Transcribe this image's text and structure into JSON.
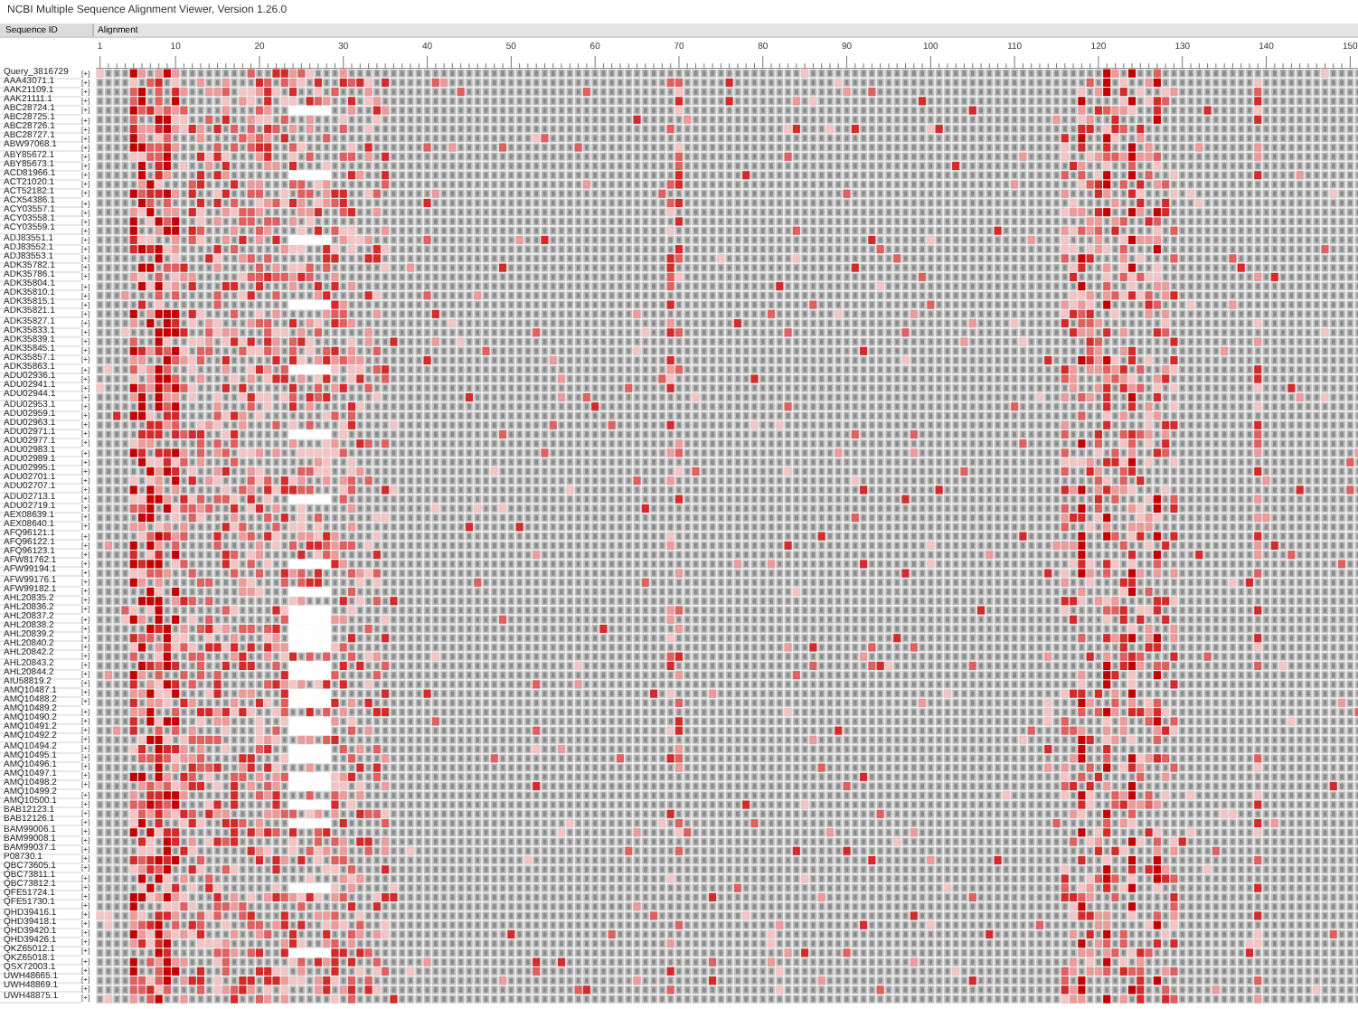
{
  "window": {
    "title": "NCBI Multiple Sequence Alignment Viewer, Version 1.26.0"
  },
  "header": {
    "columns": [
      "Sequence ID",
      "Alignment"
    ]
  },
  "ruler": {
    "labels": [
      "1",
      "10",
      "20",
      "30",
      "40",
      "50",
      "60",
      "70",
      "80",
      "90",
      "100",
      "110",
      "120",
      "130",
      "140",
      "150"
    ]
  },
  "rows": [
    {
      "id": "Query_3816729",
      "expander": "[+]"
    },
    {
      "id": "AAA43071.1",
      "expander": "[+]"
    },
    {
      "id": "AAK21109.1",
      "expander": "[+]"
    },
    {
      "id": "AAK21111.1",
      "expander": "[+]"
    },
    {
      "id": "ABC28724.1",
      "expander": "[+]"
    },
    {
      "id": "ABC28725.1",
      "expander": "[+]"
    },
    {
      "id": "ABC28726.1",
      "expander": "[+]"
    },
    {
      "id": "ABC28727.1",
      "expander": "[+]"
    },
    {
      "id": "ABW97068.1",
      "expander": "[+]"
    },
    {
      "id": "ABY85672.1",
      "expander": "[+]"
    },
    {
      "id": "ABY85673.1",
      "expander": "[+]"
    },
    {
      "id": "ACD81966.1",
      "expander": "[+]"
    },
    {
      "id": "ACT21020.1",
      "expander": "[+]"
    },
    {
      "id": "ACT52182.1",
      "expander": "[+]"
    },
    {
      "id": "ACX54386.1",
      "expander": "[+]"
    },
    {
      "id": "ACY03557.1",
      "expander": "[+]"
    },
    {
      "id": "ACY03558.1",
      "expander": "[+]"
    },
    {
      "id": "ACY03559.1",
      "expander": "[+]"
    },
    {
      "id": "ADJ83551.1",
      "expander": "[+]"
    },
    {
      "id": "ADJ83552.1",
      "expander": "[+]"
    },
    {
      "id": "ADJ83553.1",
      "expander": "[+]"
    },
    {
      "id": "ADK35782.1",
      "expander": "[+]"
    },
    {
      "id": "ADK35786.1",
      "expander": "[+]"
    },
    {
      "id": "ADK35804.1",
      "expander": "[+]"
    },
    {
      "id": "ADK35810.1",
      "expander": "[+]"
    },
    {
      "id": "ADK35815.1",
      "expander": "[+]"
    },
    {
      "id": "ADK35821.1",
      "expander": "[+]"
    },
    {
      "id": "ADK35827.1",
      "expander": "[+]"
    },
    {
      "id": "ADK35833.1",
      "expander": "[+]"
    },
    {
      "id": "ADK35839.1",
      "expander": "[+]"
    },
    {
      "id": "ADK35845.1",
      "expander": "[+]"
    },
    {
      "id": "ADK35857.1",
      "expander": "[+]"
    },
    {
      "id": "ADK35863.1",
      "expander": "[+]"
    },
    {
      "id": "ADU02936.1",
      "expander": "[+]"
    },
    {
      "id": "ADU02941.1",
      "expander": "[+]"
    },
    {
      "id": "ADU02944.1",
      "expander": "[+]"
    },
    {
      "id": "ADU02953.1",
      "expander": "[+]"
    },
    {
      "id": "ADU02959.1",
      "expander": "[+]"
    },
    {
      "id": "ADU02963.1",
      "expander": "[+]"
    },
    {
      "id": "ADU02971.1",
      "expander": "[+]"
    },
    {
      "id": "ADU02977.1",
      "expander": "[+]"
    },
    {
      "id": "ADU02983.1",
      "expander": "[+]"
    },
    {
      "id": "ADU02989.1",
      "expander": "[+]"
    },
    {
      "id": "ADU02995.1",
      "expander": "[+]"
    },
    {
      "id": "ADU02701.1",
      "expander": "[+]"
    },
    {
      "id": "ADU02707.1",
      "expander": "[+]"
    },
    {
      "id": "ADU02713.1",
      "expander": "[+]"
    },
    {
      "id": "ADU02719.1",
      "expander": "[+]"
    },
    {
      "id": "AEX08639.1",
      "expander": "[+]"
    },
    {
      "id": "AEX08640.1",
      "expander": "[+]"
    },
    {
      "id": "AFQ96121.1",
      "expander": "[+]"
    },
    {
      "id": "AFQ96122.1",
      "expander": "[+]"
    },
    {
      "id": "AFQ96123.1",
      "expander": "[+]"
    },
    {
      "id": "AFW81762.1",
      "expander": "[+]"
    },
    {
      "id": "AFW99194.1",
      "expander": "[+]"
    },
    {
      "id": "AFW99176.1",
      "expander": "[+]"
    },
    {
      "id": "AFW99182.1",
      "expander": "[+]"
    },
    {
      "id": "AHL20835.2",
      "expander": "[+]"
    },
    {
      "id": "AHL20836.2",
      "expander": "[+]"
    },
    {
      "id": "AHL20837.2",
      "expander": "[+]"
    },
    {
      "id": "AHL20838.2",
      "expander": "[+]"
    },
    {
      "id": "AHL20839.2",
      "expander": "[+]"
    },
    {
      "id": "AHL20840.2",
      "expander": "[+]"
    },
    {
      "id": "AHL20842.2",
      "expander": "[+]"
    },
    {
      "id": "AHL20843.2",
      "expander": "[+]"
    },
    {
      "id": "AHL20844.2",
      "expander": "[+]"
    },
    {
      "id": "AIU58819.2",
      "expander": "[+]"
    },
    {
      "id": "AMQ10487.1",
      "expander": "[+]"
    },
    {
      "id": "AMQ10488.2",
      "expander": "[+]"
    },
    {
      "id": "AMQ10489.2",
      "expander": "[+]"
    },
    {
      "id": "AMQ10490.2",
      "expander": "[+]"
    },
    {
      "id": "AMQ10491.2",
      "expander": "[+]"
    },
    {
      "id": "AMQ10492.2",
      "expander": "[+]"
    },
    {
      "id": "AMQ10494.2",
      "expander": "[+]"
    },
    {
      "id": "AMQ10495.1",
      "expander": "[+]"
    },
    {
      "id": "AMQ10496.1",
      "expander": "[+]"
    },
    {
      "id": "AMQ10497.1",
      "expander": "[+]"
    },
    {
      "id": "AMQ10498.2",
      "expander": "[+]"
    },
    {
      "id": "AMQ10499.2",
      "expander": "[+]"
    },
    {
      "id": "AMQ10500.1",
      "expander": "[+]"
    },
    {
      "id": "BAB12123.1",
      "expander": "[+]"
    },
    {
      "id": "BAB12126.1",
      "expander": "[+]"
    },
    {
      "id": "BAM99006.1",
      "expander": "[+]"
    },
    {
      "id": "BAM99008.1",
      "expander": "[+]"
    },
    {
      "id": "BAM99037.1",
      "expander": "[+]"
    },
    {
      "id": "P08730.1",
      "expander": "[+]"
    },
    {
      "id": "QBC73605.1",
      "expander": "[+]"
    },
    {
      "id": "QBC73811.1",
      "expander": "[+]"
    },
    {
      "id": "QBC73812.1",
      "expander": "[+]"
    },
    {
      "id": "QFE51724.1",
      "expander": "[+]"
    },
    {
      "id": "QFE51730.1",
      "expander": "[+]"
    },
    {
      "id": "QHD39416.1",
      "expander": "[+]"
    },
    {
      "id": "QHD39418.1",
      "expander": "[+]"
    },
    {
      "id": "QHD39420.1",
      "expander": "[+]"
    },
    {
      "id": "QHD39426.1",
      "expander": "[+]"
    },
    {
      "id": "QKZ65012.1",
      "expander": "[+]"
    },
    {
      "id": "QKZ65018.1",
      "expander": "[+]"
    },
    {
      "id": "QSX72003.1",
      "expander": "[+]"
    },
    {
      "id": "UWH48665.1",
      "expander": "[+]"
    },
    {
      "id": "UWH48869.1",
      "expander": "[+]"
    },
    {
      "id": "UWH48875.1",
      "expander": "[+]"
    }
  ]
}
